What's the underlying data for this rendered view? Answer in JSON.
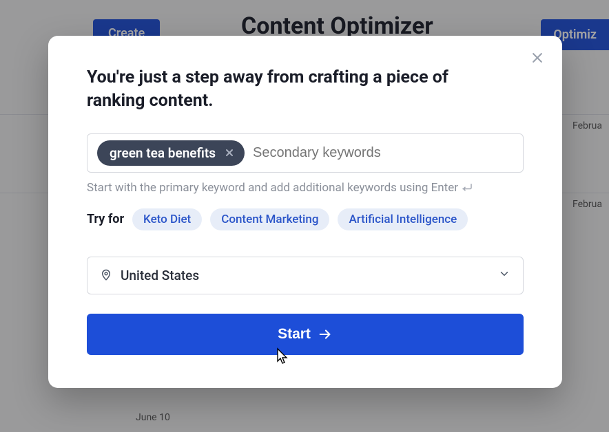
{
  "background": {
    "page_title": "Content Optimizer",
    "create_button": "Create",
    "optimize_button": "Optimiz",
    "date_labels": {
      "feb": "Februa",
      "jun": "June 10"
    }
  },
  "modal": {
    "title": "You're just a step away from crafting a piece of ranking content.",
    "keyword_chip": "green tea benefits",
    "secondary_placeholder": "Secondary keywords",
    "hint": "Start with the primary keyword and add additional keywords using Enter",
    "try_label": "Try for",
    "suggestions": [
      "Keto Diet",
      "Content Marketing",
      "Artificial Intelligence"
    ],
    "region": "United States",
    "start_label": "Start"
  }
}
